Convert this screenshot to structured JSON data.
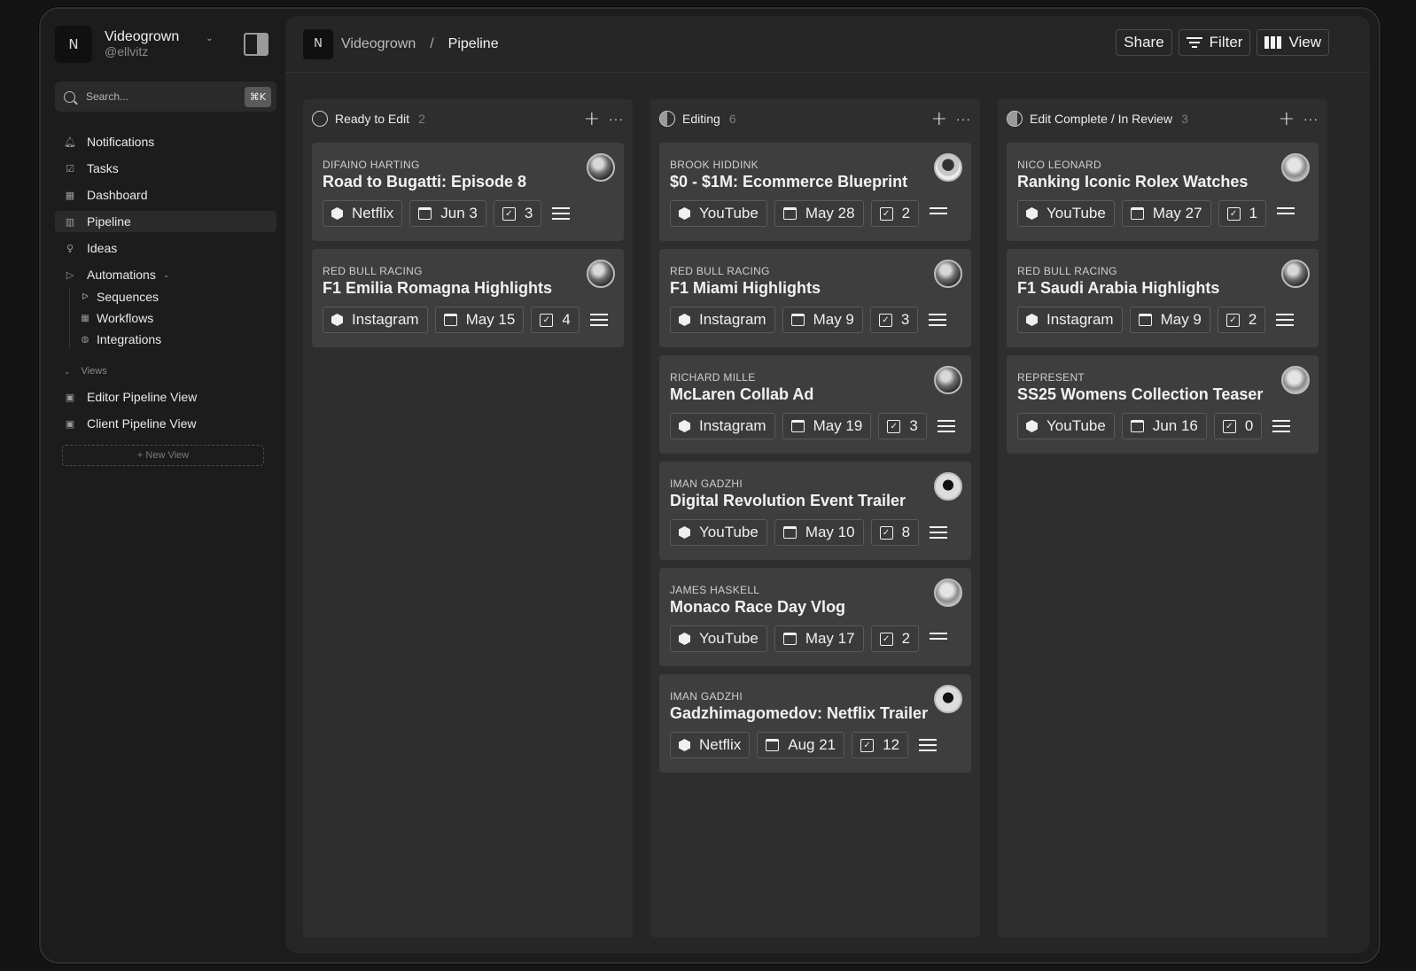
{
  "workspace": {
    "logo": "N",
    "name": "Videogrown",
    "handle": "@ellvitz"
  },
  "search": {
    "placeholder": "Search...",
    "shortcut": "⌘K"
  },
  "sidebar": {
    "items": [
      {
        "label": "Notifications",
        "icon": "bell-icon"
      },
      {
        "label": "Tasks",
        "icon": "check-square-icon"
      },
      {
        "label": "Dashboard",
        "icon": "grid-icon"
      },
      {
        "label": "Pipeline",
        "icon": "kanban-icon"
      },
      {
        "label": "Ideas",
        "icon": "lightbulb-icon"
      },
      {
        "label": "Automations",
        "icon": "play-icon"
      }
    ],
    "automations": [
      {
        "label": "Sequences",
        "icon": "send-icon"
      },
      {
        "label": "Workflows",
        "icon": "grid-icon"
      },
      {
        "label": "Integrations",
        "icon": "globe-icon"
      }
    ],
    "views_label": "Views",
    "views": [
      {
        "label": "Editor Pipeline View",
        "icon": "user-board-icon"
      },
      {
        "label": "Client Pipeline View",
        "icon": "user-board-icon"
      }
    ],
    "new_view": "+ New View"
  },
  "topbar": {
    "logo": "N",
    "breadcrumb": [
      "Videogrown",
      "/",
      "Pipeline"
    ],
    "share": "Share",
    "filter": "Filter",
    "view": "View"
  },
  "columns": [
    {
      "title": "Ready to Edit",
      "count": "2",
      "cards": [
        {
          "client": "DIFAINO HARTING",
          "title": "Road to Bugatti: Episode 8",
          "platform": "Netflix",
          "date": "Jun 3",
          "tasks": "3"
        },
        {
          "client": "RED BULL RACING",
          "title": "F1 Emilia Romagna Highlights",
          "platform": "Instagram",
          "date": "May 15",
          "tasks": "4"
        }
      ]
    },
    {
      "title": "Editing",
      "count": "6",
      "cards": [
        {
          "client": "BROOK HIDDINK",
          "title": "$0 - $1M: Ecommerce Blueprint",
          "platform": "YouTube",
          "date": "May 28",
          "tasks": "2"
        },
        {
          "client": "RED BULL RACING",
          "title": "F1 Miami Highlights",
          "platform": "Instagram",
          "date": "May 9",
          "tasks": "3"
        },
        {
          "client": "RICHARD MILLE",
          "title": "McLaren Collab Ad",
          "platform": "Instagram",
          "date": "May 19",
          "tasks": "3"
        },
        {
          "client": "IMAN GADZHI",
          "title": "Digital Revolution Event Trailer",
          "platform": "YouTube",
          "date": "May 10",
          "tasks": "8"
        },
        {
          "client": "JAMES HASKELL",
          "title": "Monaco Race Day Vlog",
          "platform": "YouTube",
          "date": "May 17",
          "tasks": "2"
        },
        {
          "client": "IMAN GADZHI",
          "title": "Gadzhimagomedov: Netflix Trailer",
          "platform": "Netflix",
          "date": "Aug 21",
          "tasks": "12"
        }
      ]
    },
    {
      "title": "Edit Complete / In Review",
      "count": "3",
      "cards": [
        {
          "client": "NICO LEONARD",
          "title": "Ranking Iconic Rolex Watches",
          "platform": "YouTube",
          "date": "May 27",
          "tasks": "1"
        },
        {
          "client": "RED BULL RACING",
          "title": "F1 Saudi Arabia Highlights",
          "platform": "Instagram",
          "date": "May 9",
          "tasks": "2"
        },
        {
          "client": "REPRESENT",
          "title": "SS25 Womens Collection Teaser",
          "platform": "YouTube",
          "date": "Jun 16",
          "tasks": "0"
        }
      ]
    }
  ]
}
